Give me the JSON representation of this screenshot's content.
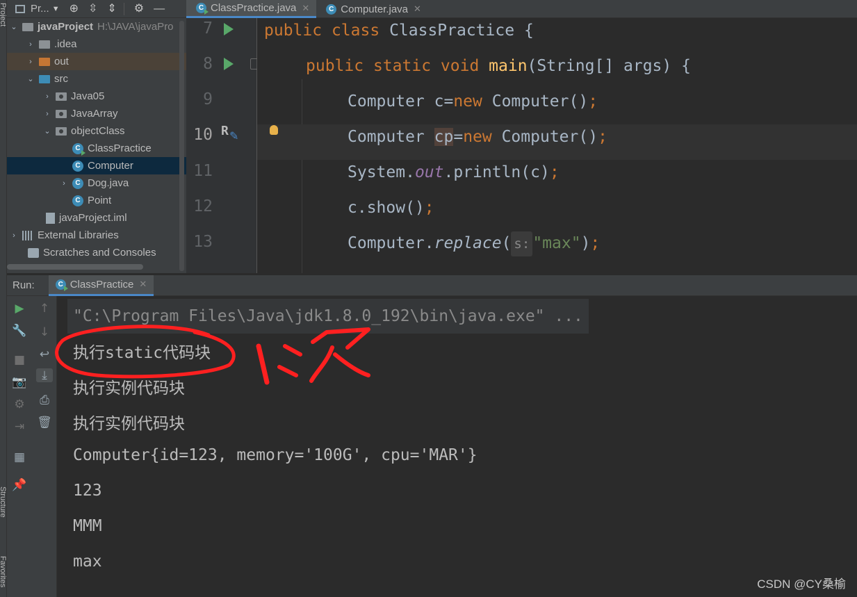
{
  "sidebar": {
    "project_label": "Project",
    "structure_label": "Structure",
    "favorites_label": "Favorites"
  },
  "project_toolbar": {
    "view_selector": "Pr...",
    "icons": [
      "dropdown-icon",
      "locate-icon",
      "expand-all-icon",
      "collapse-all-icon",
      "gear-icon",
      "minimize-icon"
    ]
  },
  "tree": {
    "root_name": "javaProject",
    "root_path": "H:\\JAVA\\javaPro",
    "items": [
      {
        "label": "javaProject",
        "icon": "folder-icon"
      },
      {
        "label": ".idea",
        "icon": "folder-icon"
      },
      {
        "label": "out",
        "icon": "folder-icon"
      },
      {
        "label": "src",
        "icon": "folder-icon"
      },
      {
        "label": "Java05",
        "icon": "package-icon"
      },
      {
        "label": "JavaArray",
        "icon": "package-icon"
      },
      {
        "label": "objectClass",
        "icon": "package-icon"
      },
      {
        "label": "ClassPractice",
        "icon": "class-icon"
      },
      {
        "label": "Computer",
        "icon": "class-icon"
      },
      {
        "label": "Dog.java",
        "icon": "class-icon"
      },
      {
        "label": "Point",
        "icon": "class-icon"
      },
      {
        "label": "javaProject.iml",
        "icon": "file-icon"
      },
      {
        "label": "External Libraries",
        "icon": "library-icon"
      },
      {
        "label": "Scratches and Consoles",
        "icon": "scratches-icon"
      }
    ]
  },
  "editor_tabs": [
    {
      "label": "ClassPractice.java",
      "active": true
    },
    {
      "label": "Computer.java",
      "active": false
    }
  ],
  "editor": {
    "line_numbers": [
      "7",
      "8",
      "9",
      "10",
      "11",
      "12",
      "13"
    ],
    "gutter_marks": {
      "vcs_mark": "R"
    },
    "code": {
      "l7": {
        "kw1": "public",
        "kw2": "class",
        "name": "ClassPractice",
        "brace": "{"
      },
      "l8": {
        "kw1": "public",
        "kw2": "static",
        "kw3": "void",
        "fn": "main",
        "rest": "(String[] args) {"
      },
      "l9": {
        "a": "Computer c=",
        "kw": "new",
        "b": " Computer()",
        "semi": ";"
      },
      "l10": {
        "a": "Computer ",
        "var": "cp",
        "eq": "=",
        "kw": "new",
        "b": " Computer()",
        "semi": ";"
      },
      "l11": {
        "a": "System.",
        "st": "out",
        "b": ".println(c)",
        "semi": ";"
      },
      "l12": {
        "a": "c.show()",
        "semi": ";"
      },
      "l13": {
        "a": "Computer.",
        "it": "replace",
        "paren": "(",
        "hint": "s:",
        "str": "\"max\"",
        "close": ")",
        "semi": ";"
      }
    }
  },
  "run_panel": {
    "label": "Run:",
    "tab": "ClassPractice",
    "console_lines": [
      "\"C:\\Program Files\\Java\\jdk1.8.0_192\\bin\\java.exe\" ...",
      "执行static代码块",
      "执行实例代码块",
      "执行实例代码块",
      "Computer{id=123, memory='100G', cpu='MAR'}",
      "123",
      "MMM",
      "max"
    ]
  },
  "watermark": "CSDN @CY桑榆",
  "colors": {
    "annotation": "#ff2020",
    "keyword": "#cc7832",
    "function": "#ffc66d",
    "string": "#6a8759",
    "static_field": "#9876aa",
    "selection": "#0d293e",
    "tab_underline": "#4a88c7",
    "run_green": "#59a869"
  }
}
